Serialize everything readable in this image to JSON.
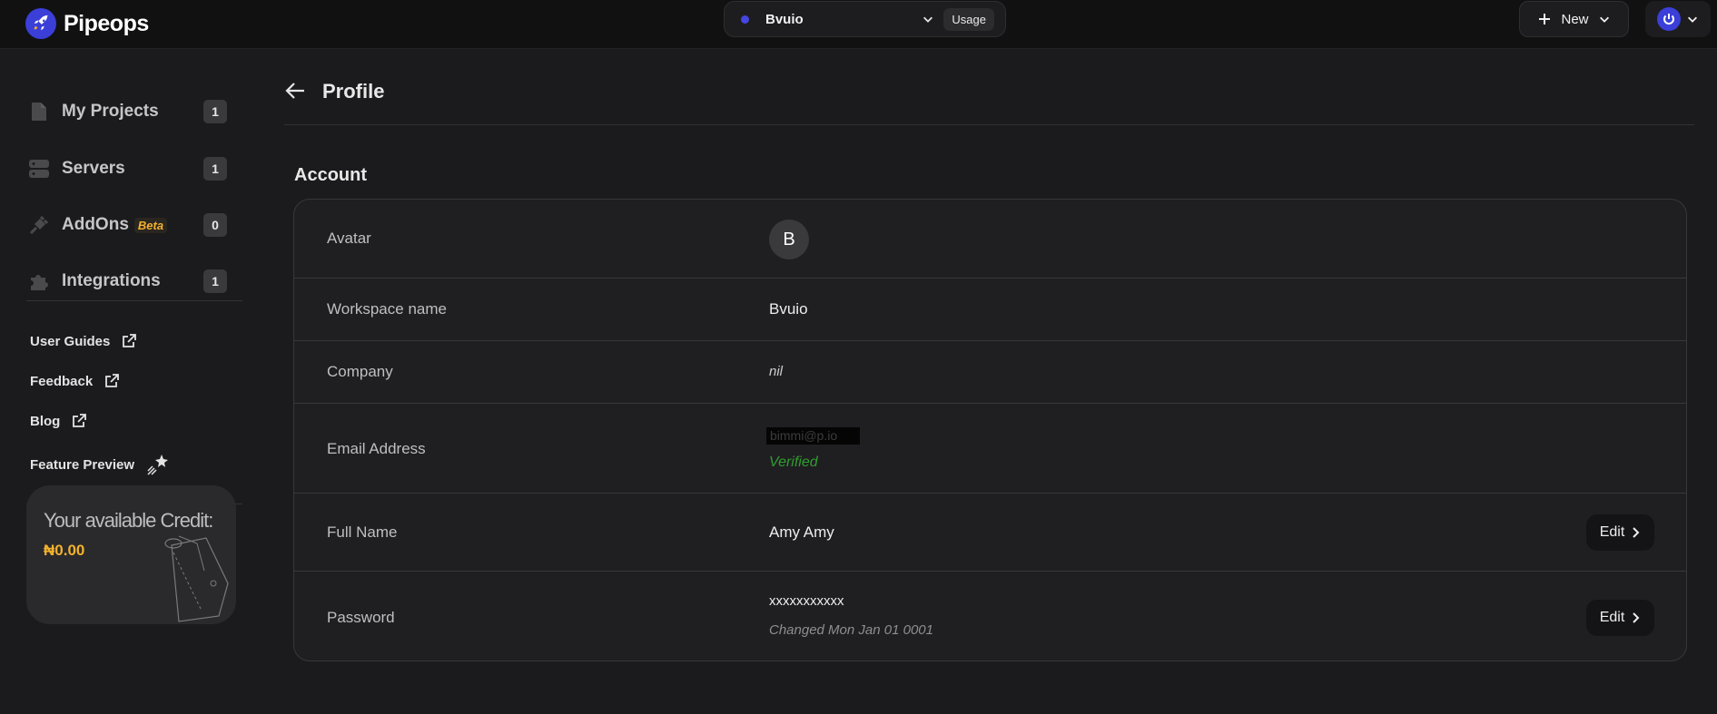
{
  "app": {
    "name": "Pipeops"
  },
  "topbar": {
    "workspace_name": "Bvuio",
    "usage_label": "Usage",
    "new_label": "New"
  },
  "sidebar": {
    "nav": [
      {
        "label": "My Projects",
        "count": "1",
        "icon": "file-icon"
      },
      {
        "label": "Servers",
        "count": "1",
        "icon": "server-icon"
      },
      {
        "label": "AddOns",
        "badge": "Beta",
        "count": "0",
        "icon": "plug-icon"
      },
      {
        "label": "Integrations",
        "count": "1",
        "icon": "puzzle-icon"
      }
    ],
    "links": [
      {
        "label": "User Guides",
        "icon": "external-link-icon"
      },
      {
        "label": "Feedback",
        "icon": "external-link-icon"
      },
      {
        "label": "Blog",
        "icon": "external-link-icon"
      },
      {
        "label": "Feature Preview",
        "icon": "sparkle-star-icon"
      }
    ],
    "credit": {
      "title": "Your available Credit:",
      "amount": "₦0.00"
    }
  },
  "main": {
    "page_title": "Profile",
    "section_title": "Account",
    "rows": {
      "avatar": {
        "label": "Avatar",
        "initial": "B"
      },
      "workspace": {
        "label": "Workspace name",
        "value": "Bvuio"
      },
      "company": {
        "label": "Company",
        "value": "nil"
      },
      "email": {
        "label": "Email Address",
        "value": "bimmi@p.io",
        "status": "Verified"
      },
      "full_name": {
        "label": "Full Name",
        "value": "Amy Amy",
        "edit_label": "Edit"
      },
      "password": {
        "label": "Password",
        "value": "xxxxxxxxxxx",
        "changed": "Changed Mon Jan 01 0001",
        "edit_label": "Edit"
      }
    }
  },
  "colors": {
    "accent": "#3b3fd8",
    "credit": "#f2b22d",
    "verified": "#2f9e2f",
    "background": "#1b1b1d"
  }
}
